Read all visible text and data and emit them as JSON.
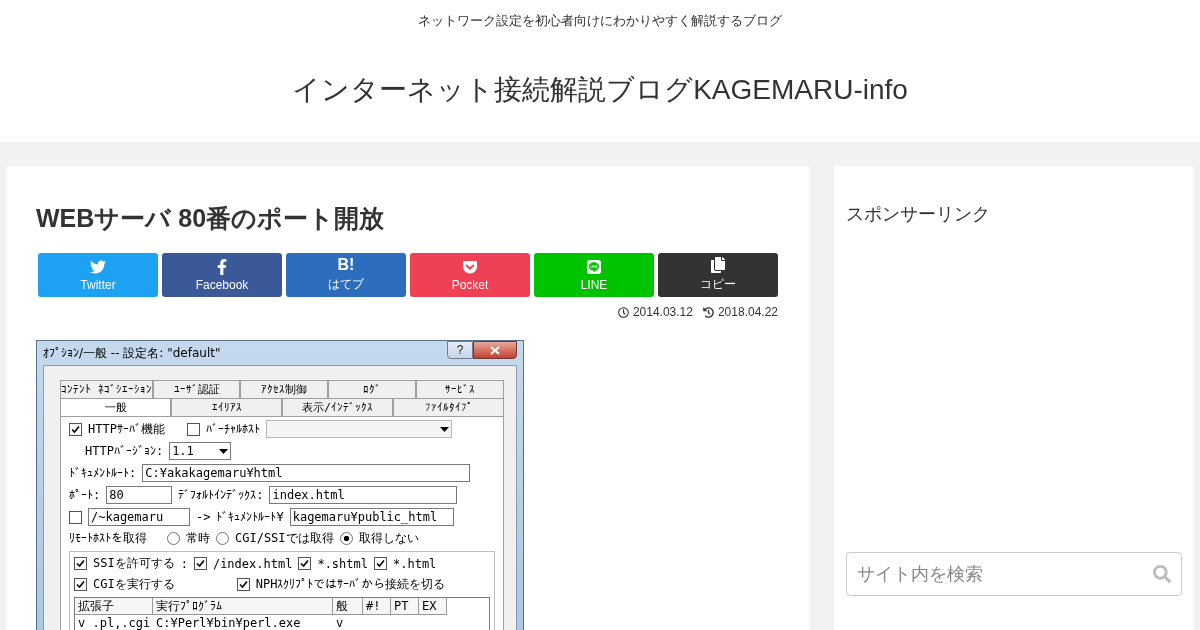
{
  "header": {
    "tagline": "ネットワーク設定を初心者向けにわかりやすく解説するブログ",
    "site_title": "インターネット接続解説ブログKAGEMARU-info"
  },
  "article": {
    "title": "WEBサーバ 80番のポート開放",
    "share_buttons": [
      {
        "kind": "twitter",
        "label": "Twitter",
        "color": "#1da1f2"
      },
      {
        "kind": "facebook",
        "label": "Facebook",
        "color": "#3b5998"
      },
      {
        "kind": "hatena",
        "label": "はてブ",
        "glyph": "B!",
        "color": "#2c6ebd"
      },
      {
        "kind": "pocket",
        "label": "Pocket",
        "color": "#ef4056"
      },
      {
        "kind": "line",
        "label": "LINE",
        "color": "#00c300"
      },
      {
        "kind": "copy",
        "label": "コピー",
        "color": "#333333"
      }
    ],
    "dates": [
      {
        "kind": "posted",
        "text": "2014.03.12"
      },
      {
        "kind": "updated",
        "text": "2018.04.22"
      }
    ],
    "dialog": {
      "title": "ｵﾌﾟｼｮﾝ/一般 -- 設定名: \"default\"",
      "help": "?",
      "tabs_back": [
        {
          "label": "ｺﾝﾃﾝﾄ ﾈｺﾞｼｴｰｼｮﾝ"
        },
        {
          "label": "ﾕｰｻﾞ認証"
        },
        {
          "label": "ｱｸｾｽ制御"
        },
        {
          "label": "ﾛｸﾞ"
        },
        {
          "label": "ｻｰﾋﾞｽ"
        }
      ],
      "tabs_front": [
        {
          "label": "一般",
          "selected": true
        },
        {
          "label": "ｴｲﾘｱｽ",
          "selected": false
        },
        {
          "label": "表示/ｲﾝﾃﾞｯｸｽ",
          "selected": false
        },
        {
          "label": "ﾌｧｲﾙﾀｲﾌﾟ",
          "selected": false
        }
      ],
      "http_server": {
        "label": "HTTPｻｰﾊﾞ機能",
        "checked": true
      },
      "virtual_host": {
        "label": "ﾊﾞｰﾁｬﾙﾎｽﾄ",
        "checked": false
      },
      "http_version": {
        "label": "HTTPﾊﾞｰｼﾞｮﾝ:",
        "value": "1.1"
      },
      "document_root": {
        "label": "ﾄﾞｷｭﾒﾝﾄﾙｰﾄ:",
        "value": "C:¥akakagemaru¥html"
      },
      "port": {
        "label": "ﾎﾟｰﾄ:",
        "value": "80"
      },
      "default_index": {
        "label": "ﾃﾞﾌｫﾙﾄｲﾝﾃﾞｯｸｽ:",
        "value": "index.html"
      },
      "user_dir": {
        "checked": false,
        "value": "/~kagemaru",
        "arrow": "->",
        "label": "ﾄﾞｷｭﾒﾝﾄﾙｰﾄ¥",
        "target": "kagemaru¥public_html"
      },
      "remote_host": {
        "label": "ﾘﾓｰﾄﾎｽﾄを取得",
        "options": [
          {
            "label": "常時",
            "selected": false
          },
          {
            "label": "CGI/SSIでは取得",
            "selected": false
          },
          {
            "label": "取得しない",
            "selected": true
          }
        ]
      },
      "ssi": {
        "label": "SSIを許可する",
        "checked": true,
        "separator": ":",
        "patterns": [
          {
            "label": "/index.html",
            "checked": true
          },
          {
            "label": "*.shtml",
            "checked": true
          },
          {
            "label": "*.html",
            "checked": true
          }
        ]
      },
      "cgi": {
        "label": "CGIを実行する",
        "checked": true
      },
      "nph": {
        "label": "NPHｽｸﾘﾌﾟﾄではｻｰﾊﾞから接続を切る",
        "checked": true
      },
      "handlers": {
        "columns": [
          "拡張子",
          "実行ﾌﾟﾛｸﾞﾗﾑ",
          "般",
          "#!",
          "PT",
          "EX"
        ],
        "rows": [
          {
            "mark": "v",
            "extension": ".pl,.cgi",
            "program": "C:¥Perl¥bin¥perl.exe",
            "general": "v"
          }
        ]
      }
    }
  },
  "sidebar": {
    "heading": "スポンサーリンク",
    "search": {
      "placeholder": "サイト内を検索"
    }
  }
}
